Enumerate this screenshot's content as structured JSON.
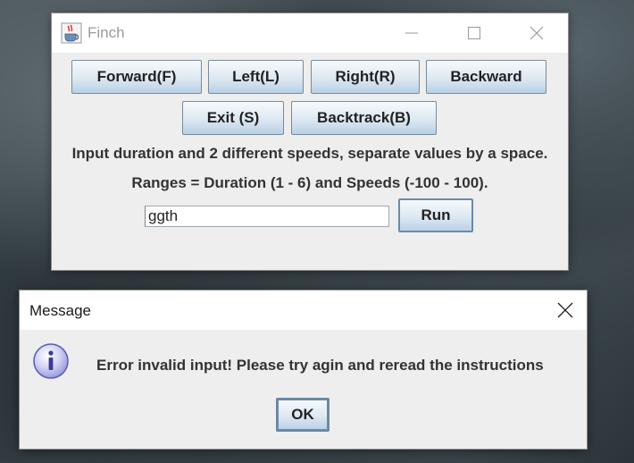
{
  "finch_window": {
    "title": "Finch",
    "icon": "java-coffee-cup-icon",
    "controls": {
      "minimize_icon": "minimize-icon",
      "maximize_icon": "maximize-icon",
      "close_icon": "close-icon"
    },
    "buttons": {
      "forward": "Forward(F)",
      "left": "Left(L)",
      "right": "Right(R)",
      "backward": "Backward",
      "exit": "Exit (S)",
      "backtrack": "Backtrack(B)",
      "run": "Run"
    },
    "instructions": {
      "line1": "Input duration and 2 different speeds, separate values by a space.",
      "line2": "Ranges = Duration (1 - 6) and Speeds (-100 - 100)."
    },
    "input": {
      "value": "ggth",
      "placeholder": ""
    }
  },
  "message_dialog": {
    "title": "Message",
    "icon": "info-icon",
    "close_icon": "close-icon",
    "message": "Error invalid input! Please try agin and reread the instructions",
    "ok_label": "OK"
  },
  "colors": {
    "window_bg": "#eeeeee",
    "titlebar_bg": "#ffffff",
    "button_gradient_top": "#f7fafc",
    "button_gradient_bottom": "#b9d0e5",
    "info_icon_fill": "#c9c9f2",
    "info_icon_stroke": "#5a5ab4"
  }
}
